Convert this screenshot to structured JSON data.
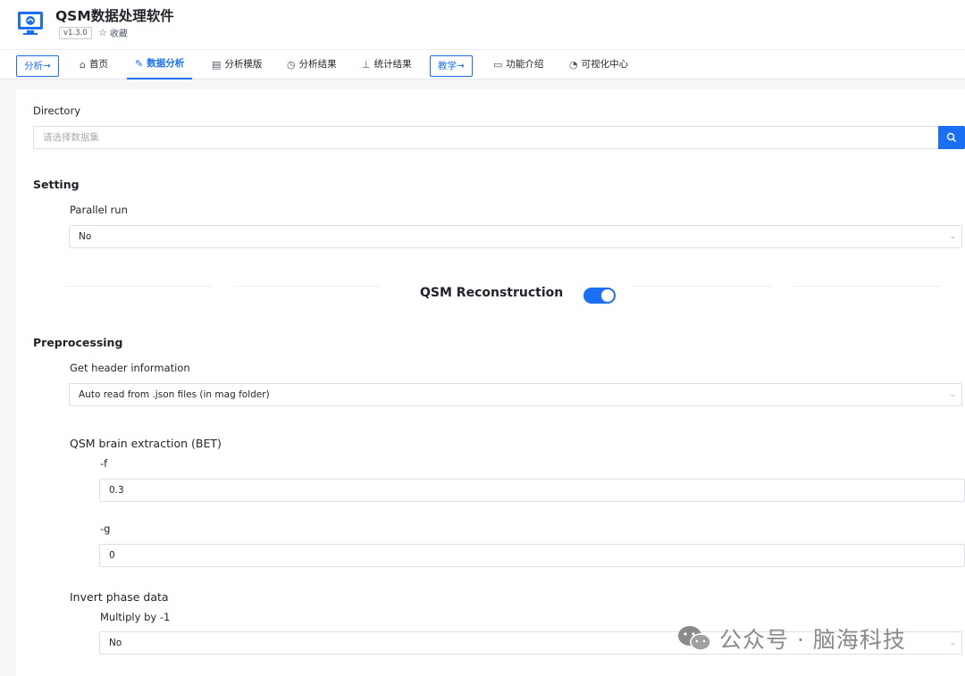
{
  "app": {
    "title": "QSM数据处理软件",
    "version": "v1.3.0",
    "favorite_label": "收藏"
  },
  "nav": {
    "analysis_btn": "分析→",
    "items": [
      {
        "label": "首页",
        "icon": "home-icon"
      },
      {
        "label": "数据分析",
        "icon": "edit-icon",
        "active": true
      },
      {
        "label": "分析模版",
        "icon": "document-icon"
      },
      {
        "label": "分析结果",
        "icon": "clock-icon"
      },
      {
        "label": "统计结果",
        "icon": "bar-chart-icon"
      }
    ],
    "teach_btn": "教学→",
    "items2": [
      {
        "label": "功能介绍",
        "icon": "monitor-icon"
      },
      {
        "label": "可视化中心",
        "icon": "pie-icon"
      }
    ]
  },
  "form": {
    "directory_label": "Directory",
    "directory_placeholder": "请选择数据集",
    "setting_title": "Setting",
    "parallel_label": "Parallel run",
    "parallel_value": "No",
    "recon_title": "QSM Reconstruction",
    "preprocessing_title": "Preprocessing",
    "header_label": "Get header information",
    "header_value": "Auto read from .json files (in mag folder)",
    "bet_title": "QSM brain extraction (BET)",
    "f_label": "-f",
    "f_value": "0.3",
    "g_label": "-g",
    "g_value": "0",
    "invert_title": "Invert phase data",
    "multiply_label": "Multiply by -1",
    "multiply_value": "No"
  },
  "watermark": {
    "text": "公众号 · 脑海科技"
  },
  "colors": {
    "accent": "#1a6ff5",
    "border": "#dcdfe6",
    "text": "#1f2329"
  }
}
